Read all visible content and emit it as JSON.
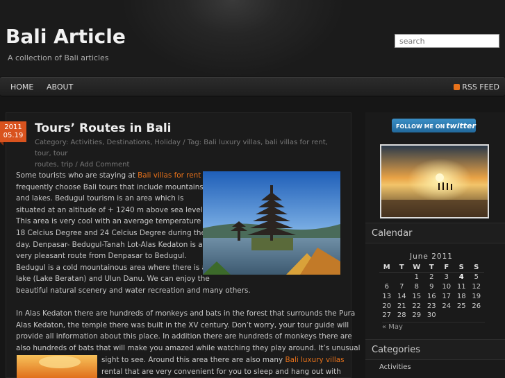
{
  "site": {
    "title": "Bali Article",
    "description": "A collection of Bali articles",
    "search_placeholder": "search"
  },
  "nav": {
    "items": [
      "HOME",
      "ABOUT"
    ],
    "rss_label": "RSS FEED"
  },
  "post": {
    "date_year": "2011",
    "date_day": "05.19",
    "title": "Tours’ Routes in Bali",
    "meta_line1": "Category: Activities, Destinations, Holiday / Tag: Bali luxury villas, bali villas for rent, tour, tour",
    "meta_line2": "routes, trip / Add Comment",
    "p1_lines": [
      {
        "pre": "Some tourists who are staying at ",
        "link": "Bali villas for rent",
        "post": ""
      },
      {
        "pre": "frequently choose Bali tours that include mountains",
        "link": "",
        "post": ""
      },
      {
        "pre": "and lakes. Bedugul tourism is an area which is",
        "link": "",
        "post": ""
      },
      {
        "pre": "situated at an altitude of + 1240 m above sea level.",
        "link": "",
        "post": ""
      },
      {
        "pre": "This area is very cool with an average temperature of",
        "link": "",
        "post": ""
      },
      {
        "pre": "18 Celcius Degree and 24 Celcius Degree during the",
        "link": "",
        "post": ""
      },
      {
        "pre": "day. Denpasar- Bedugul-Tanah Lot-Alas Kedaton is a",
        "link": "",
        "post": ""
      },
      {
        "pre": "very pleasant route from Denpasar to Bedugul.",
        "link": "",
        "post": ""
      },
      {
        "pre": "Bedugul is a cold mountainous area where there is a",
        "link": "",
        "post": ""
      },
      {
        "pre": "lake (Lake Beratan) and Ulun Danu. We can enjoy the",
        "link": "",
        "post": ""
      },
      {
        "pre": "beautiful natural scenery and water recreation and many others.",
        "link": "",
        "post": ""
      }
    ],
    "p2_lines": [
      "In Alas Kedaton there are hundreds of monkeys and bats in the forest that surrounds the Pura",
      "Alas Kedaton, the temple there was built in the XV century. Don’t worry, your tour guide will",
      "provide all information about this place. In addition there are hundreds of monkeys there are",
      "also hundreds of bats that will make you amazed while watching they play around. It’s unusual"
    ],
    "p3_line1_pre": "sight to see. Around this area there are also many ",
    "p3_line1_link": "Bali luxury villas",
    "p3_line2": "rental that are very convenient for you to sleep and hang out with"
  },
  "sidebar": {
    "follow_prefix": "FOLLOW ME ON",
    "follow_brand": "twitter",
    "calendar_title": "Calendar",
    "calendar_caption": "June 2011",
    "weekdays": [
      "M",
      "T",
      "W",
      "T",
      "F",
      "S",
      "S"
    ],
    "weeks": [
      [
        "",
        "",
        "1",
        "2",
        "3",
        "4",
        "5"
      ],
      [
        "6",
        "7",
        "8",
        "9",
        "10",
        "11",
        "12"
      ],
      [
        "13",
        "14",
        "15",
        "16",
        "17",
        "18",
        "19"
      ],
      [
        "20",
        "21",
        "22",
        "23",
        "24",
        "25",
        "26"
      ],
      [
        "27",
        "28",
        "29",
        "30",
        "",
        "",
        ""
      ]
    ],
    "today": "4",
    "prev_month": "« May",
    "categories_title": "Categories",
    "categories": [
      "Activities"
    ]
  },
  "colors": {
    "accent": "#e8721b",
    "badge": "#d9531e",
    "twitter": "#2a7ab3"
  }
}
